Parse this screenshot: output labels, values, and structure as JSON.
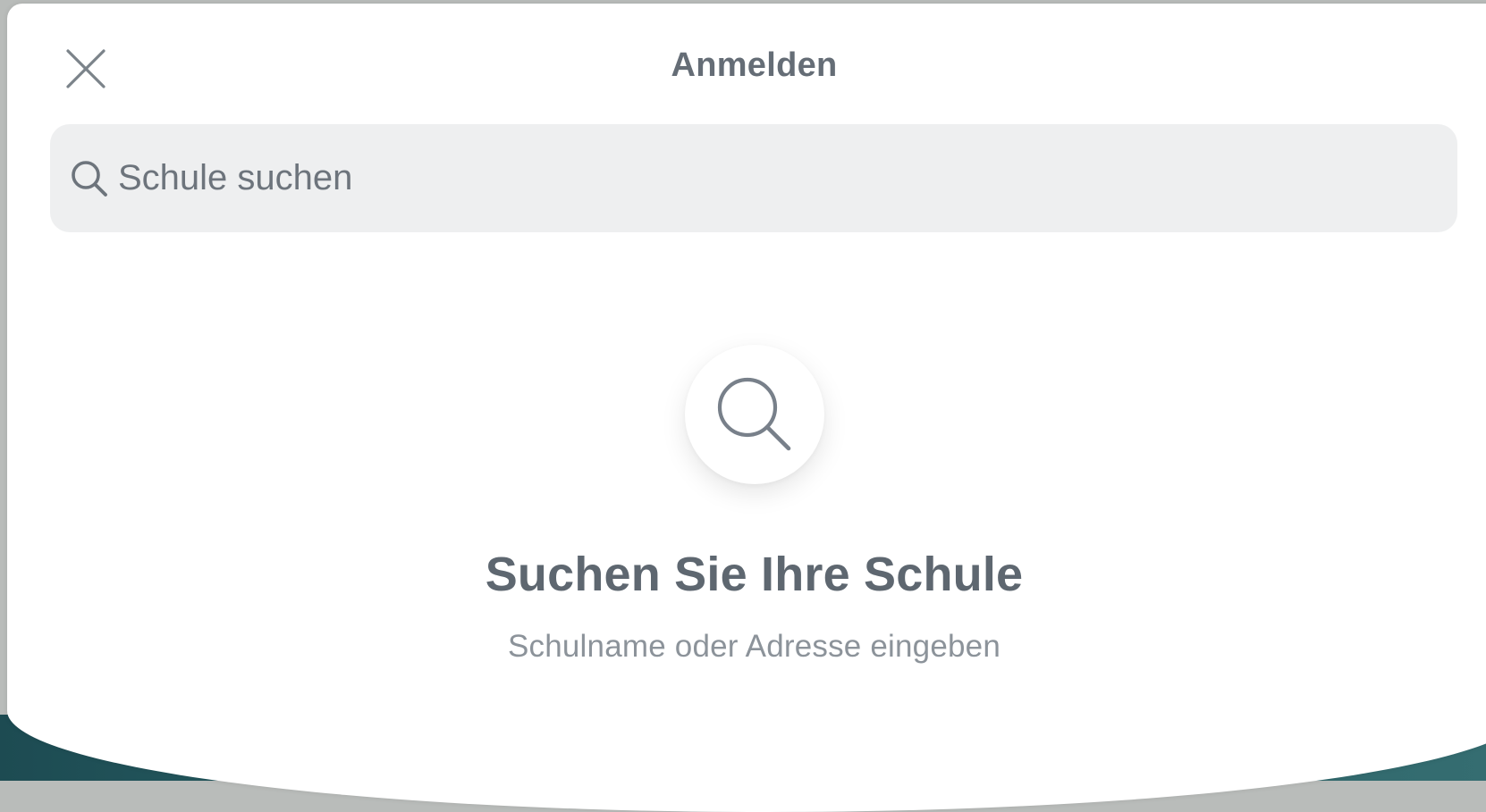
{
  "header": {
    "title": "Anmelden",
    "close_icon": "close-icon"
  },
  "search": {
    "placeholder": "Schule suchen",
    "value": "",
    "icon": "search-icon"
  },
  "empty_state": {
    "icon": "search-icon",
    "heading": "Suchen Sie Ihre Schule",
    "subtext": "Schulname oder Adresse eingeben"
  },
  "colors": {
    "title_text": "#656d76",
    "search_background": "#eeeff0",
    "background_teal": "#2d6a6f"
  }
}
